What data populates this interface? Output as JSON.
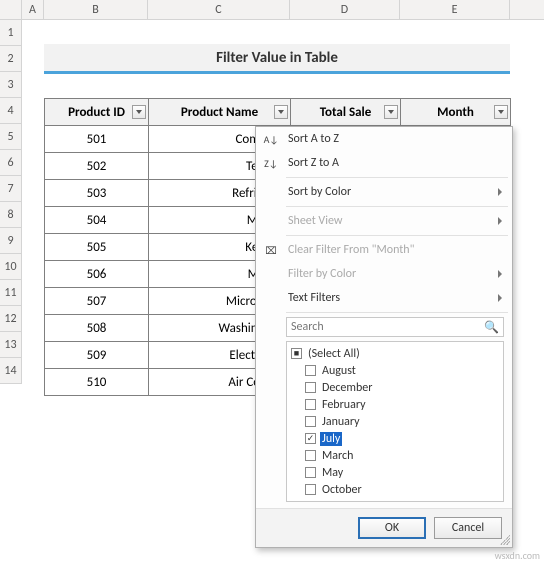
{
  "columns": [
    "A",
    "B",
    "C",
    "D",
    "E"
  ],
  "rows": [
    "1",
    "2",
    "3",
    "4",
    "5",
    "6",
    "7",
    "8",
    "9",
    "10",
    "11",
    "12",
    "13",
    "14"
  ],
  "title": "Filter Value in Table",
  "table": {
    "headers": [
      "Product ID",
      "Product Name",
      "Total Sale",
      "Month"
    ],
    "rows": [
      {
        "id": "501",
        "name": "Compute"
      },
      {
        "id": "502",
        "name": "Televisi"
      },
      {
        "id": "503",
        "name": "Refrigerat"
      },
      {
        "id": "504",
        "name": "Mobile"
      },
      {
        "id": "505",
        "name": "Keyboa"
      },
      {
        "id": "506",
        "name": "Mouse"
      },
      {
        "id": "507",
        "name": "Microwave"
      },
      {
        "id": "508",
        "name": "Washing Ma"
      },
      {
        "id": "509",
        "name": "Electric Ke"
      },
      {
        "id": "510",
        "name": "Air Conditi"
      }
    ]
  },
  "menu": {
    "sort_az": "Sort A to Z",
    "sort_za": "Sort Z to A",
    "sort_color": "Sort by Color",
    "sheet_view": "Sheet View",
    "clear_filter": "Clear Filter From \"Month\"",
    "filter_color": "Filter by Color",
    "text_filters": "Text Filters",
    "search_placeholder": "Search",
    "items": [
      {
        "label": "(Select All)",
        "checked": "partial",
        "first": true
      },
      {
        "label": "August",
        "checked": false
      },
      {
        "label": "December",
        "checked": false
      },
      {
        "label": "February",
        "checked": false
      },
      {
        "label": "January",
        "checked": false
      },
      {
        "label": "July",
        "checked": true,
        "selected": true
      },
      {
        "label": "March",
        "checked": false
      },
      {
        "label": "May",
        "checked": false
      },
      {
        "label": "October",
        "checked": false
      }
    ],
    "ok": "OK",
    "cancel": "Cancel"
  },
  "watermark": "wsxdn.com"
}
